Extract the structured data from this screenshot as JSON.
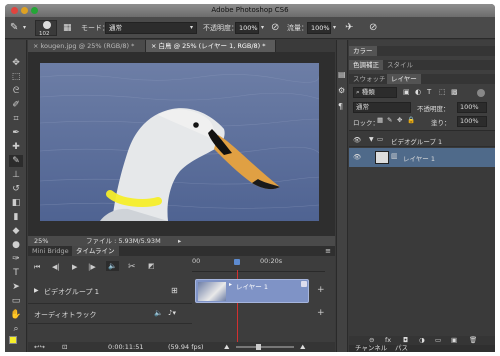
{
  "window": {
    "title": "Adobe Photoshop CS6"
  },
  "options_bar": {
    "brush_size": "102",
    "mode_label": "モード：",
    "mode_value": "通常",
    "opacity_label": "不透明度：",
    "opacity_value": "100%",
    "flow_label": "流量：",
    "flow_value": "100%"
  },
  "document_tabs": [
    {
      "label": "kougen.jpg @ 25% (RGB/8) *"
    },
    {
      "label": "白鳥 @ 25% (レイヤー 1, RGB/8) *"
    }
  ],
  "status_bar": {
    "zoom": "25%",
    "file_info": "ファイル : 5.93M/5.93M"
  },
  "timeline": {
    "tabs": [
      "Mini Bridge",
      "タイムライン"
    ],
    "ruler_start": "00",
    "ruler_mark": "00:20s",
    "group_label": "ビデオグループ 1",
    "clip_label": "レイヤー 1",
    "audio_label": "オーディオトラック",
    "timecode": "0:00:11:51",
    "fps": "(59.94 fps)"
  },
  "right_panels": {
    "color_tab": "カラー",
    "adjust_tabs": [
      "色調補正",
      "スタイル"
    ],
    "layer_tabs": [
      "スウォッチ",
      "レイヤー"
    ],
    "filter_kind": "種類",
    "blend_mode": "通常",
    "opacity_label": "不透明度：",
    "opacity_value": "100%",
    "lock_label": "ロック：",
    "fill_label": "塗り：",
    "fill_value": "100%",
    "layers": [
      {
        "name": "ビデオグループ 1"
      },
      {
        "name": "レイヤー 1"
      }
    ],
    "bottom_tabs": [
      "チャンネル",
      "パス"
    ]
  },
  "colors": {
    "highlight_ring": "#f5ee2a",
    "playhead": "#d23030",
    "selection": "#4f6a8a"
  }
}
